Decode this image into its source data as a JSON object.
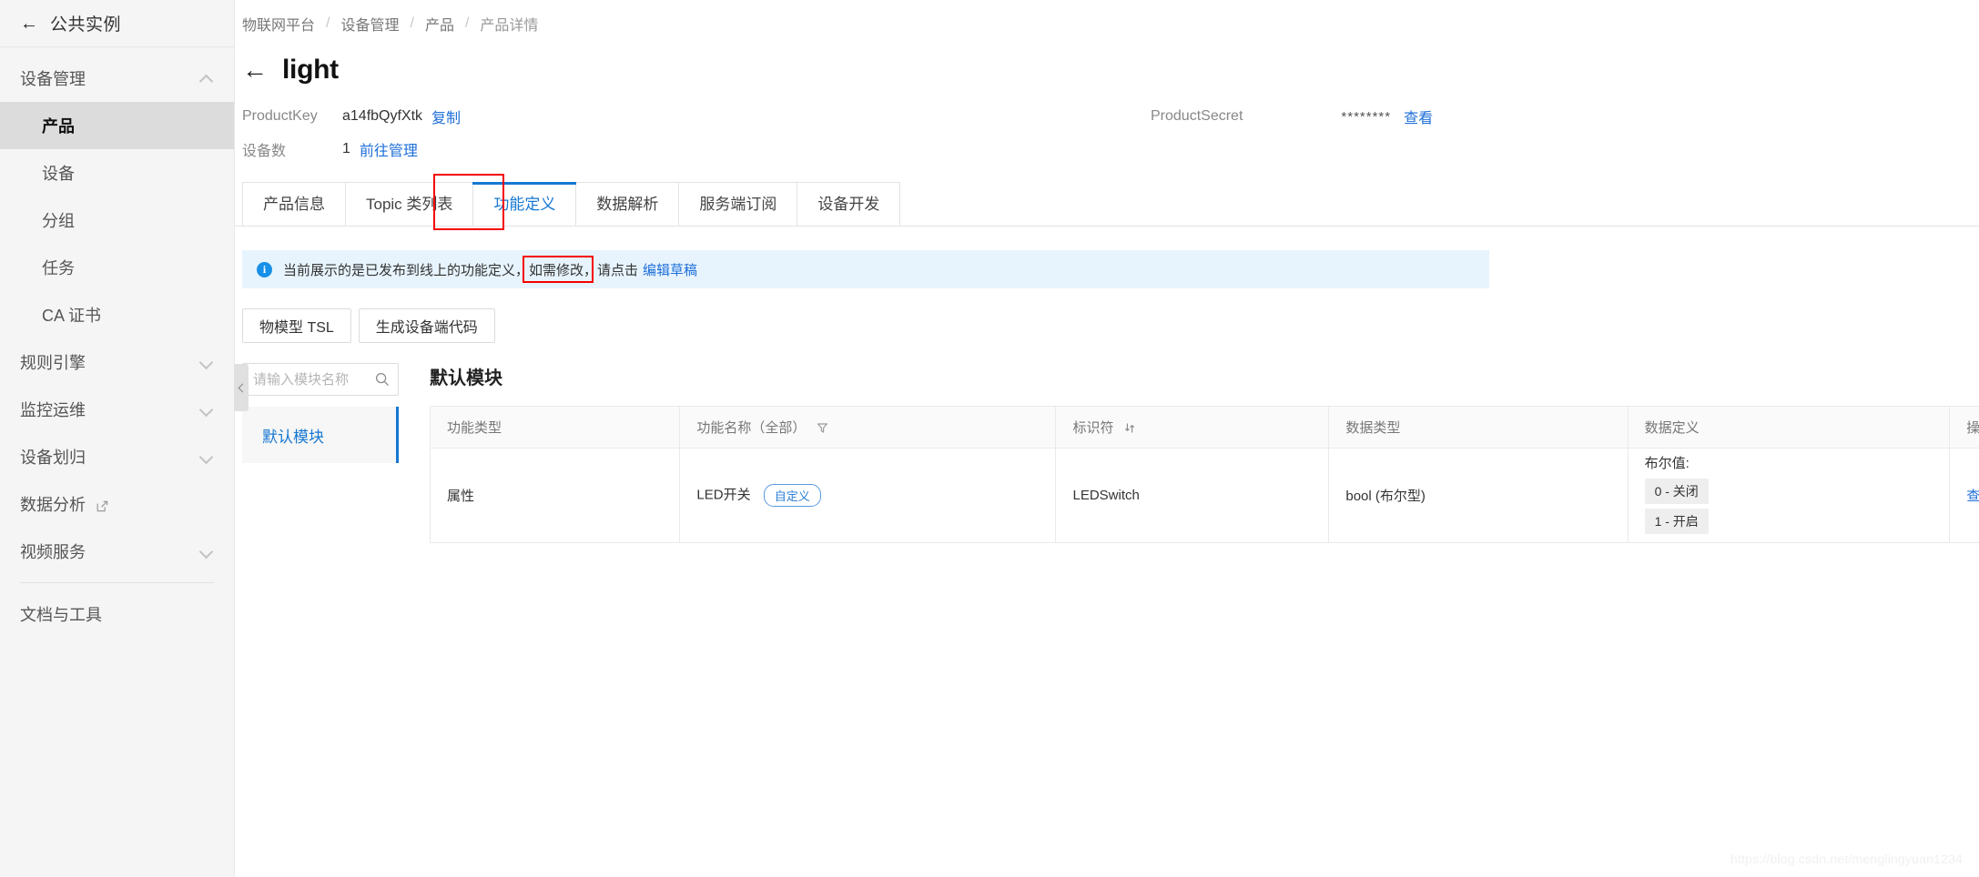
{
  "sidebar": {
    "instance": {
      "label": "公共实例",
      "back_icon": "arrow-left-icon"
    },
    "groups": [
      {
        "label": "设备管理",
        "expanded": true,
        "items": [
          {
            "label": "产品",
            "active": true
          },
          {
            "label": "设备",
            "active": false
          },
          {
            "label": "分组",
            "active": false
          },
          {
            "label": "任务",
            "active": false
          },
          {
            "label": "CA 证书",
            "active": false
          }
        ]
      },
      {
        "label": "规则引擎",
        "expanded": false,
        "items": []
      },
      {
        "label": "监控运维",
        "expanded": false,
        "items": []
      },
      {
        "label": "设备划归",
        "expanded": false,
        "items": []
      }
    ],
    "data_analysis": {
      "label": "数据分析",
      "external": true
    },
    "video_service": {
      "label": "视频服务",
      "expanded": false
    },
    "docs_tools": {
      "label": "文档与工具"
    },
    "collapse_handle": "collapse-sidebar-handle"
  },
  "breadcrumb": [
    "物联网平台",
    "设备管理",
    "产品",
    "产品详情"
  ],
  "header": {
    "back_icon": "arrow-left-icon",
    "title": "light"
  },
  "product_info": {
    "product_key_label": "ProductKey",
    "product_key_value": "a14fbQyfXtk",
    "copy_label": "复制",
    "device_count_label": "设备数",
    "device_count_value": "1",
    "manage_label": "前往管理",
    "product_secret_label": "ProductSecret",
    "product_secret_value": "********",
    "view_label": "查看"
  },
  "tabs": [
    {
      "label": "产品信息",
      "active": false
    },
    {
      "label": "Topic 类列表",
      "active": false
    },
    {
      "label": "功能定义",
      "active": true
    },
    {
      "label": "数据解析",
      "active": false
    },
    {
      "label": "服务端订阅",
      "active": false
    },
    {
      "label": "设备开发",
      "active": false
    }
  ],
  "alert": {
    "icon": "info-icon",
    "text": "当前展示的是已发布到线上的功能定义，如需修改，请点击",
    "link": "编辑草稿"
  },
  "actions": [
    {
      "label": "物模型 TSL"
    },
    {
      "label": "生成设备端代码"
    }
  ],
  "module_panel": {
    "search_placeholder": "请输入模块名称",
    "search_value": "",
    "search_icon": "search-icon",
    "items": [
      {
        "label": "默认模块",
        "active": true
      }
    ]
  },
  "table": {
    "title": "默认模块",
    "columns": [
      {
        "key": "type",
        "label": "功能类型",
        "icon": null
      },
      {
        "key": "name",
        "label": "功能名称（全部）",
        "icon": "filter-icon"
      },
      {
        "key": "identifier",
        "label": "标识符",
        "icon": "sort-icon"
      },
      {
        "key": "datatype",
        "label": "数据类型",
        "icon": null
      },
      {
        "key": "datadef",
        "label": "数据定义",
        "icon": null
      },
      {
        "key": "op",
        "label": "操作",
        "icon": null
      }
    ],
    "rows": [
      {
        "type": "属性",
        "name": "LED开关",
        "name_badge": "自定义",
        "identifier": "LEDSwitch",
        "datatype": "bool (布尔型)",
        "datadef_title": "布尔值:",
        "datadef_items": [
          "0 - 关闭",
          "1 - 开启"
        ],
        "op": "查看"
      }
    ]
  },
  "annotations": {
    "tab_highlight_color": "#f40000",
    "alert_highlight_color": "#f40000"
  },
  "watermark": "https://blog.csdn.net/menglingyuan1234"
}
